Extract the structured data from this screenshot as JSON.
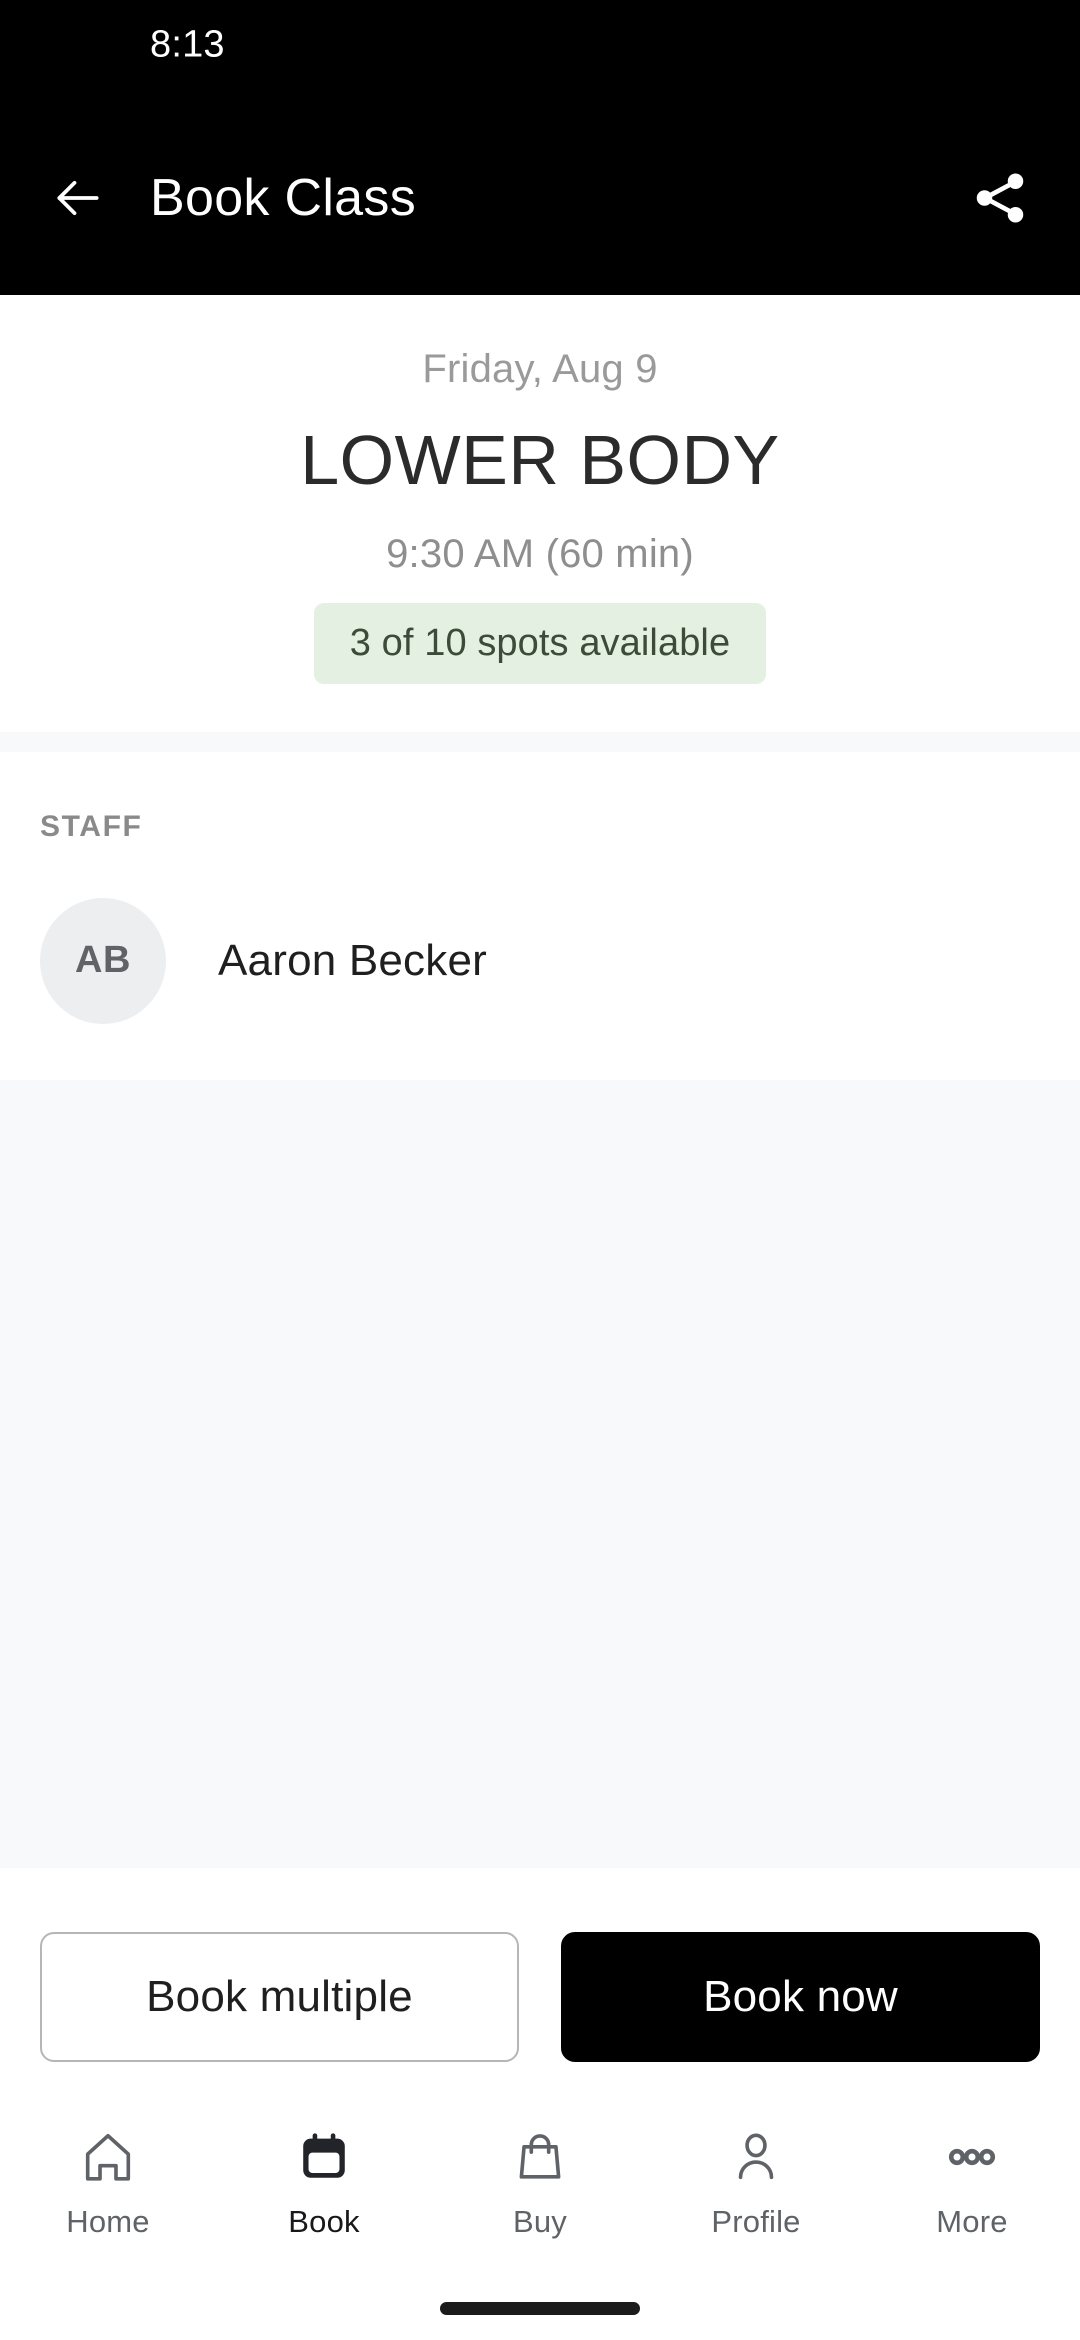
{
  "status_bar": {
    "time": "8:13"
  },
  "app_bar": {
    "title": "Book Class",
    "back_icon": "arrow-left-icon",
    "share_icon": "share-icon"
  },
  "class_info": {
    "date": "Friday, Aug 9",
    "name": "LOWER BODY",
    "time": "9:30 AM (60 min)",
    "spots": "3 of 10 spots available",
    "spots_bg": "#e4f0e1",
    "spots_text_color": "#3c4b3a"
  },
  "staff_section": {
    "label": "STAFF",
    "members": [
      {
        "initials": "AB",
        "name": "Aaron Becker"
      }
    ]
  },
  "footer": {
    "secondary_label": "Book multiple",
    "primary_label": "Book now"
  },
  "bottom_nav": {
    "items": [
      {
        "label": "Home",
        "icon": "home-icon",
        "active": false
      },
      {
        "label": "Book",
        "icon": "calendar-icon",
        "active": true
      },
      {
        "label": "Buy",
        "icon": "shopping-bag-icon",
        "active": false
      },
      {
        "label": "Profile",
        "icon": "person-icon",
        "active": false
      },
      {
        "label": "More",
        "icon": "more-dots-icon",
        "active": false
      }
    ]
  },
  "colors": {
    "app_bar_bg": "#000000",
    "page_bg": "#f7f9fb",
    "card_bg": "#ffffff",
    "primary_button": "#000000",
    "muted_text": "#8e8e8e"
  }
}
